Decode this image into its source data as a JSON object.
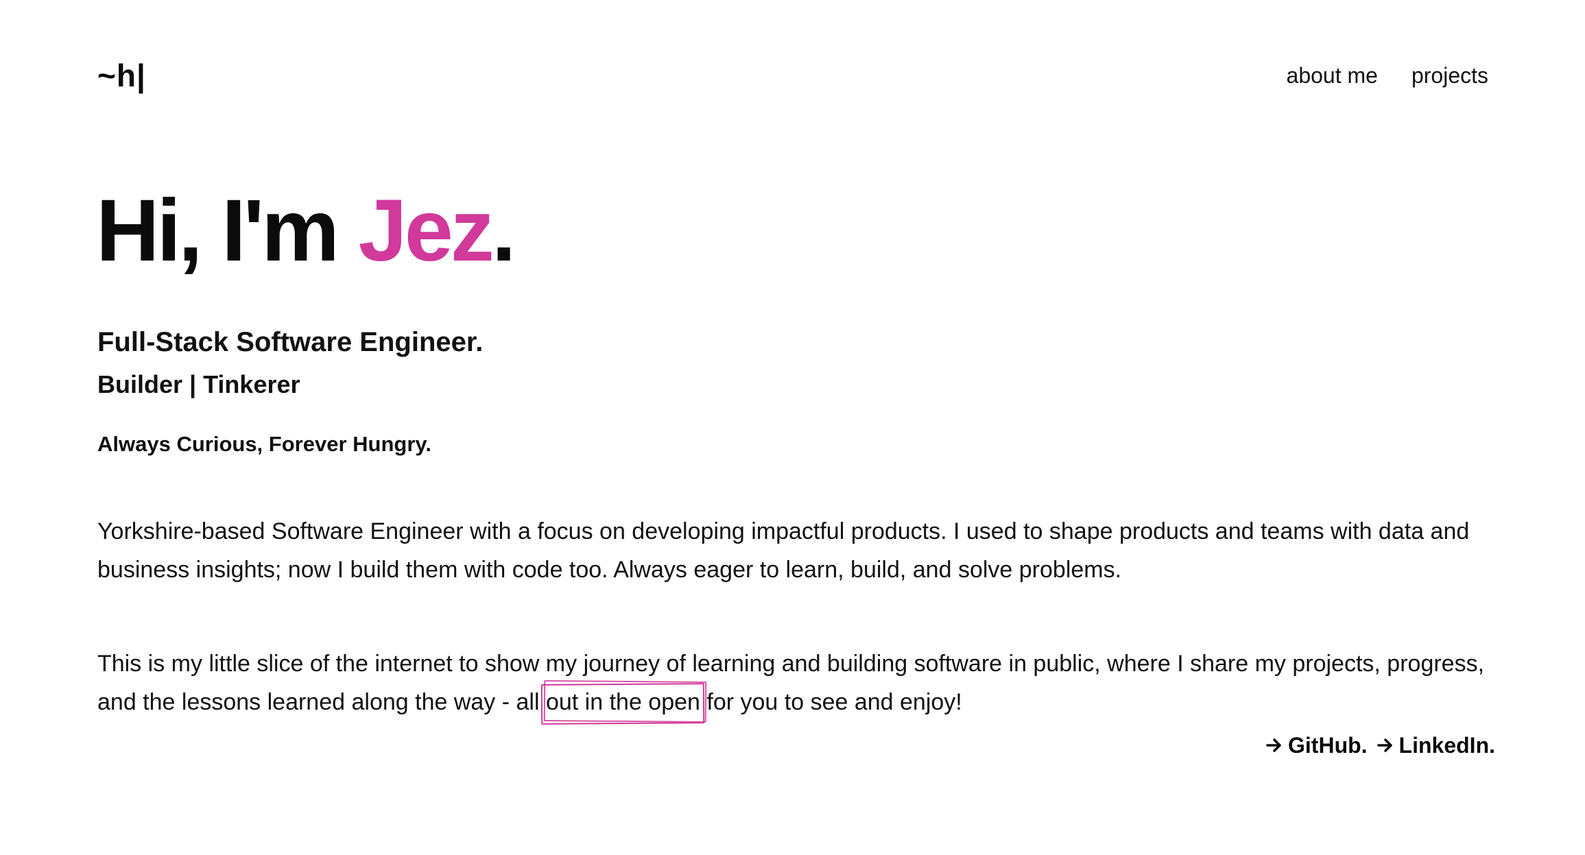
{
  "header": {
    "logo": "~h|",
    "nav": [
      {
        "label": "about me"
      },
      {
        "label": "projects"
      }
    ]
  },
  "hero": {
    "greeting": "Hi, I'm ",
    "name": "Jez",
    "punct": "."
  },
  "role": "Full-Stack Software Engineer.",
  "tagline": "Builder | Tinkerer",
  "motto": "Always Curious, Forever Hungry.",
  "about": {
    "paragraph1": "Yorkshire-based Software Engineer with a focus on developing impactful products. I used to shape products and teams with data and business insights; now I build them with code too. Always eager to learn, build, and solve problems.",
    "paragraph2_before": "This is my little slice of the internet to show my journey of learning and building software in public, where I share my projects, progress, and the lessons learned along the way - all ",
    "paragraph2_highlight": "out in the open",
    "paragraph2_after": " for you to see and enjoy!"
  },
  "social": {
    "arrow_icon": "arrow-right-icon",
    "github_label": "GitHub.",
    "linkedin_label": "LinkedIn."
  },
  "colors": {
    "accent": "#d1399a",
    "text": "#111111",
    "background": "#ffffff"
  }
}
